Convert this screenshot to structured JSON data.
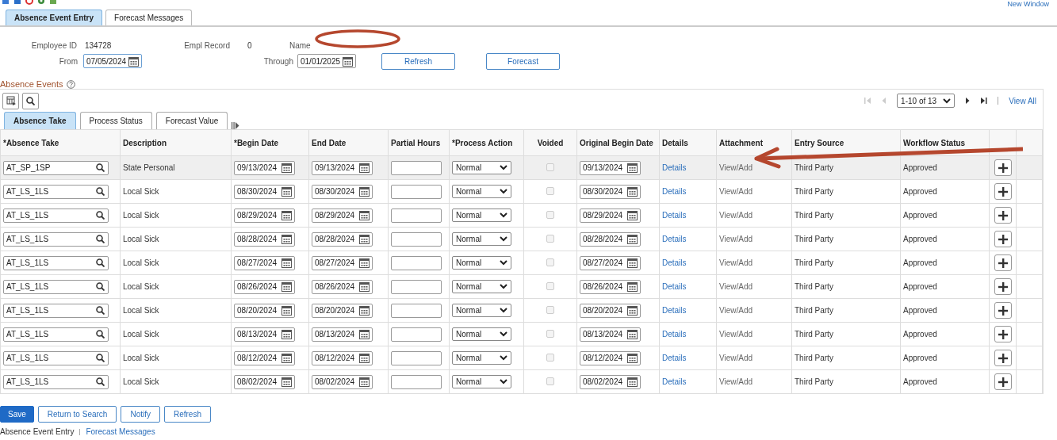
{
  "top_link": "New Window",
  "page_tabs": [
    {
      "label": "Absence Event Entry",
      "selected": true
    },
    {
      "label": "Forecast Messages",
      "selected": false
    }
  ],
  "header": {
    "employee_id_label": "Employee ID",
    "employee_id": "134728",
    "empl_record_label": "Empl Record",
    "empl_record": "0",
    "name_label": "Name",
    "from_label": "From",
    "from": "07/05/2024",
    "through_label": "Through",
    "through": "01/01/2025",
    "buttons": [
      "Refresh",
      "Forecast"
    ]
  },
  "section_title": "Absence Events",
  "pager": {
    "range": "1-10 of 13",
    "view_all": "View All"
  },
  "grid_tabs": [
    {
      "label": "Absence Take",
      "selected": true
    },
    {
      "label": "Process Status",
      "selected": false
    },
    {
      "label": "Forecast Value",
      "selected": false
    }
  ],
  "table": {
    "columns": [
      "*Absence Take",
      "Description",
      "*Begin Date",
      "End Date",
      "Partial Hours",
      "*Process Action",
      "Voided",
      "Original Begin Date",
      "Details",
      "Attachment",
      "Entry Source",
      "Workflow Status"
    ],
    "rows": [
      {
        "absence_take": "AT_SP_1SP",
        "description": "State Personal",
        "begin": "09/13/2024",
        "end": "09/13/2024",
        "action": "Normal",
        "voided": false,
        "original_begin": "09/13/2024",
        "details": "Details",
        "attachment": "View/Add",
        "source": "Third Party",
        "status": "Approved",
        "selected": true
      },
      {
        "absence_take": "AT_LS_1LS",
        "description": "Local Sick",
        "begin": "08/30/2024",
        "end": "08/30/2024",
        "action": "Normal",
        "voided": false,
        "original_begin": "08/30/2024",
        "details": "Details",
        "attachment": "View/Add",
        "source": "Third Party",
        "status": "Approved",
        "selected": false
      },
      {
        "absence_take": "AT_LS_1LS",
        "description": "Local Sick",
        "begin": "08/29/2024",
        "end": "08/29/2024",
        "action": "Normal",
        "voided": false,
        "original_begin": "08/29/2024",
        "details": "Details",
        "attachment": "View/Add",
        "source": "Third Party",
        "status": "Approved",
        "selected": false
      },
      {
        "absence_take": "AT_LS_1LS",
        "description": "Local Sick",
        "begin": "08/28/2024",
        "end": "08/28/2024",
        "action": "Normal",
        "voided": false,
        "original_begin": "08/28/2024",
        "details": "Details",
        "attachment": "View/Add",
        "source": "Third Party",
        "status": "Approved",
        "selected": false
      },
      {
        "absence_take": "AT_LS_1LS",
        "description": "Local Sick",
        "begin": "08/27/2024",
        "end": "08/27/2024",
        "action": "Normal",
        "voided": false,
        "original_begin": "08/27/2024",
        "details": "Details",
        "attachment": "View/Add",
        "source": "Third Party",
        "status": "Approved",
        "selected": false
      },
      {
        "absence_take": "AT_LS_1LS",
        "description": "Local Sick",
        "begin": "08/26/2024",
        "end": "08/26/2024",
        "action": "Normal",
        "voided": false,
        "original_begin": "08/26/2024",
        "details": "Details",
        "attachment": "View/Add",
        "source": "Third Party",
        "status": "Approved",
        "selected": false
      },
      {
        "absence_take": "AT_LS_1LS",
        "description": "Local Sick",
        "begin": "08/20/2024",
        "end": "08/20/2024",
        "action": "Normal",
        "voided": false,
        "original_begin": "08/20/2024",
        "details": "Details",
        "attachment": "View/Add",
        "source": "Third Party",
        "status": "Approved",
        "selected": false
      },
      {
        "absence_take": "AT_LS_1LS",
        "description": "Local Sick",
        "begin": "08/13/2024",
        "end": "08/13/2024",
        "action": "Normal",
        "voided": false,
        "original_begin": "08/13/2024",
        "details": "Details",
        "attachment": "View/Add",
        "source": "Third Party",
        "status": "Approved",
        "selected": false
      },
      {
        "absence_take": "AT_LS_1LS",
        "description": "Local Sick",
        "begin": "08/12/2024",
        "end": "08/12/2024",
        "action": "Normal",
        "voided": false,
        "original_begin": "08/12/2024",
        "details": "Details",
        "attachment": "View/Add",
        "source": "Third Party",
        "status": "Approved",
        "selected": false
      },
      {
        "absence_take": "AT_LS_1LS",
        "description": "Local Sick",
        "begin": "08/02/2024",
        "end": "08/02/2024",
        "action": "Normal",
        "voided": false,
        "original_begin": "08/02/2024",
        "details": "Details",
        "attachment": "View/Add",
        "source": "Third Party",
        "status": "Approved",
        "selected": false
      }
    ]
  },
  "footer_buttons": [
    {
      "label": "Save",
      "kind": "primary"
    },
    {
      "label": "Return to Search",
      "kind": "secondary"
    },
    {
      "label": "Notify",
      "kind": "secondary"
    },
    {
      "label": "Refresh",
      "kind": "secondary"
    }
  ],
  "footer_links": [
    {
      "label": "Absence Event Entry",
      "selected": true
    },
    {
      "label": "Forecast Messages",
      "selected": false
    }
  ],
  "annotations": {
    "oval": {
      "color": "#b5472e"
    },
    "arrow": {
      "color": "#b5472e"
    }
  }
}
